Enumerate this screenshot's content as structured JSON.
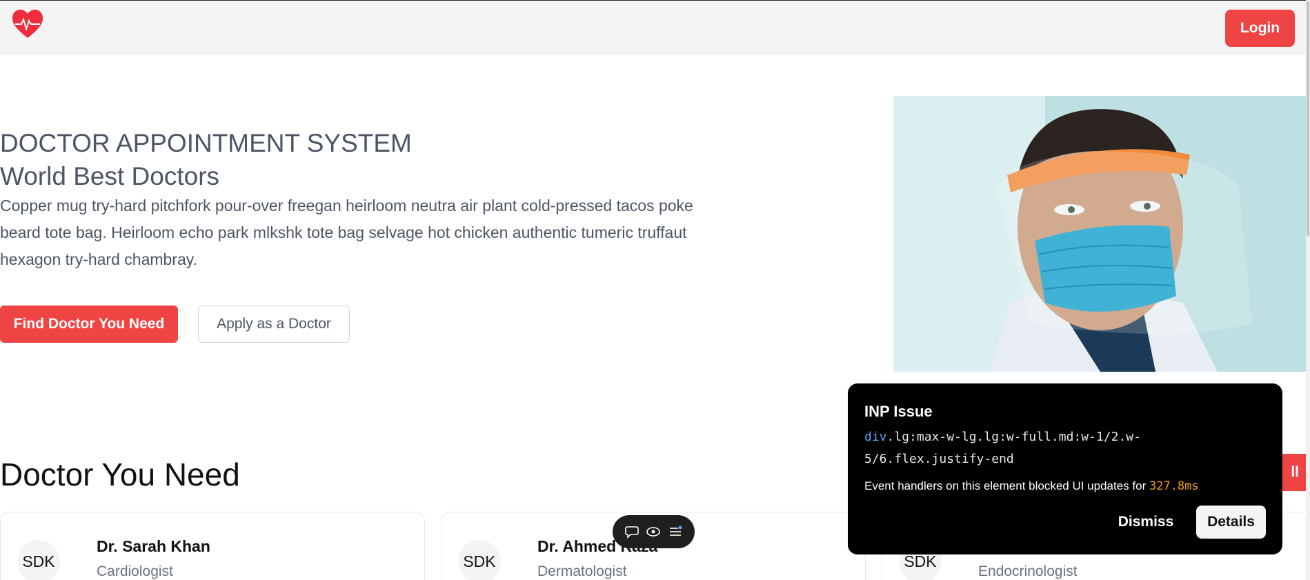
{
  "nav": {
    "logo_icon": "heart-pulse-icon",
    "login_label": "Login"
  },
  "hero": {
    "title": "DOCTOR APPOINTMENT SYSTEM",
    "subtitle": "World Best Doctors",
    "description": "Copper mug try-hard pitchfork pour-over freegan heirloom neutra air plant cold-pressed tacos poke beard tote bag. Heirloom echo park mlkshk tote bag selvage hot chicken authentic tumeric truffaut hexagon try-hard chambray.",
    "primary_button": "Find Doctor You Need",
    "secondary_button": "Apply as a Doctor",
    "image_icon": "doctor-face-shield-photo"
  },
  "section": {
    "title": "Doctor You Need",
    "see_all_partial": "ll"
  },
  "doctors": [
    {
      "initials": "SDK",
      "name": "Dr. Sarah Khan",
      "specialty": "Cardiologist"
    },
    {
      "initials": "SDK",
      "name": "Dr. Ahmed Raza",
      "specialty": "Dermatologist"
    },
    {
      "initials": "SDK",
      "name": "",
      "specialty": "Endocrinologist"
    }
  ],
  "toolbar": {
    "icons": [
      "comment-icon",
      "eye-icon",
      "menu-list-icon"
    ]
  },
  "inp_panel": {
    "title": "INP Issue",
    "selector_tag": "div",
    "selector_rest": ".lg:max-w-lg.lg:w-full.md:w-1/2.w-5/6.flex.justify-end",
    "description": "Event handlers on this element blocked UI updates for",
    "duration": "327.8ms",
    "dismiss_label": "Dismiss",
    "details_label": "Details"
  },
  "colors": {
    "accent": "#ef4444",
    "text": "#4b5563",
    "panel_bg": "#000000",
    "duration": "#f59e0b",
    "selector_tag": "#60a5fa"
  }
}
